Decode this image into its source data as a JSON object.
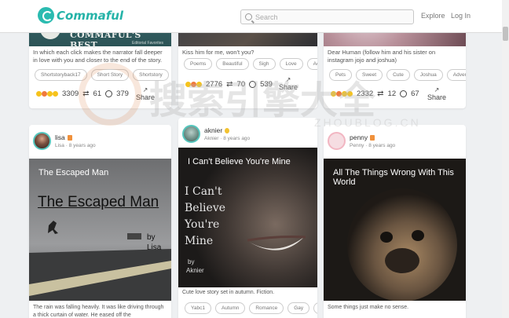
{
  "header": {
    "logo_text": "Commaful",
    "search_placeholder": "Search",
    "nav_explore": "Explore",
    "nav_login": "Log In"
  },
  "top_cards": [
    {
      "banner_text": "COMMAFUL'S BEST",
      "banner_subtext": "Editorial Favorites",
      "description": "In which each click makes the narrator fall deeper in love with you and closer to the end of the story.",
      "tags": [
        "Shortstoryback17",
        "Short Story",
        "Shortstory"
      ],
      "reactions": "3309",
      "reposts": "61",
      "comments": "379",
      "share_label": "Share"
    },
    {
      "description": "Kiss him for me, won't you?",
      "tags": [
        "Poems",
        "Beautiful",
        "Sigh",
        "Love",
        "Ac"
      ],
      "reactions": "2776",
      "reposts": "70",
      "comments": "539",
      "share_label": "Share"
    },
    {
      "description": "Dear Human (follow him and his sister on instagram jojo and joshua)",
      "tags": [
        "Pets",
        "Sweet",
        "Cute",
        "Joshua",
        "Advent"
      ],
      "reactions": "2332",
      "reposts": "12",
      "comments": "67",
      "share_label": "Share"
    }
  ],
  "bottom_cards": [
    {
      "author": "lisa",
      "time": "Lisa · 8 years ago",
      "title": "The Escaped Man",
      "cover_title": "The Escaped Man",
      "cover_byline": "by",
      "cover_author": "Lisa",
      "description": "The rain was falling heavily. It was like driving through a thick curtain of water. He eased off the"
    },
    {
      "author": "aknier",
      "time": "Aknier · 8 years ago",
      "title": "I Can't Believe You're Mine",
      "cover_title_lines": [
        "I Can't",
        "Believe",
        "You're",
        "Mine"
      ],
      "cover_byline": "by",
      "cover_author": "Aknier",
      "description": "Cute love story set in autumn. Fiction.",
      "tags": [
        "Yabc1",
        "Autumn",
        "Romance",
        "Gay",
        "C"
      ]
    },
    {
      "author": "penny",
      "time": "Penny · 8 years ago",
      "title": "All The Things Wrong With This World",
      "description": "Some things just make no sense."
    }
  ],
  "watermark": {
    "text": "搜索引擎大全",
    "subtext": "ZHOUBLOG.CN"
  },
  "colors": {
    "brand": "#25b3a8",
    "avatar_ring": "#55c6bd",
    "badge_orange": "#f0913c",
    "badge_yellow": "#f2c230"
  }
}
